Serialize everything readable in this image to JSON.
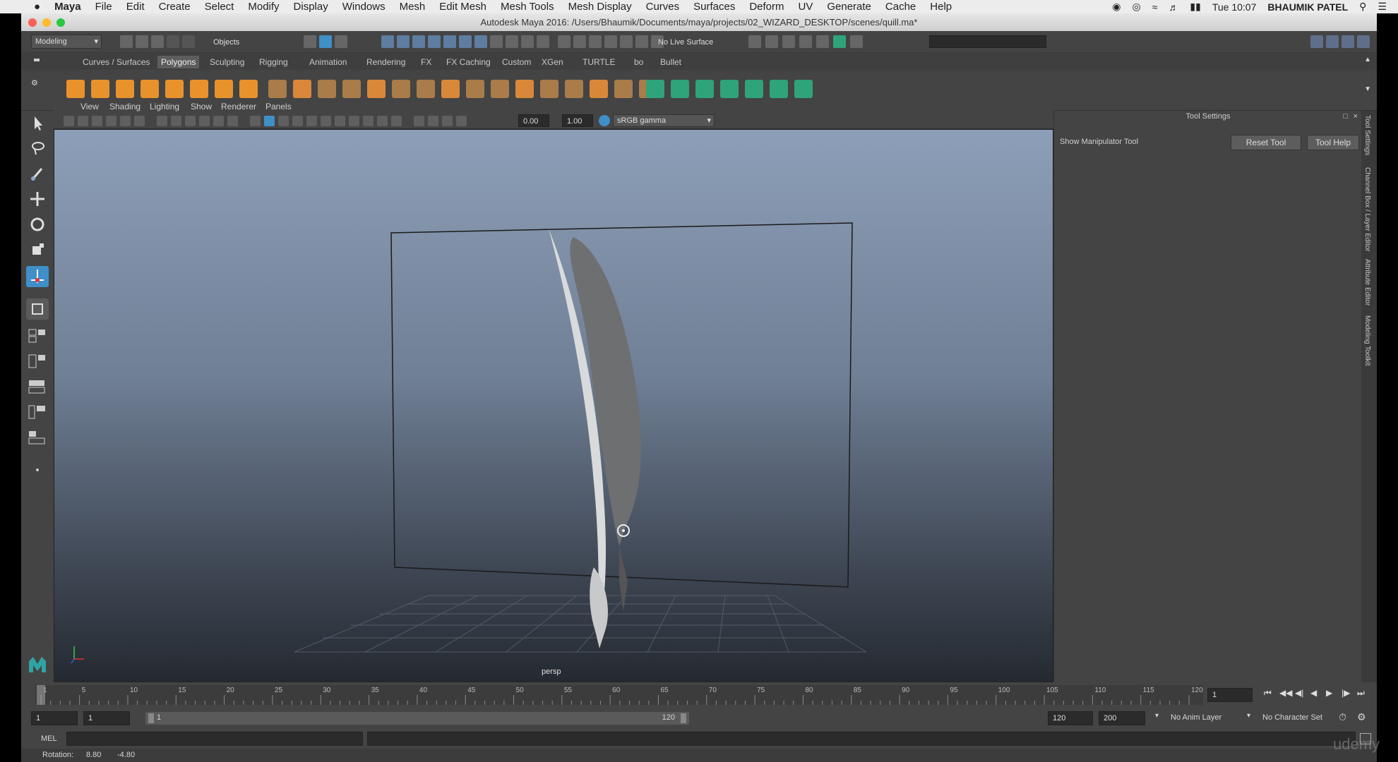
{
  "mac_menu": {
    "app_name": "Maya",
    "items": [
      "File",
      "Edit",
      "Create",
      "Select",
      "Modify",
      "Display",
      "Windows",
      "Mesh",
      "Edit Mesh",
      "Mesh Tools",
      "Mesh Display",
      "Curves",
      "Surfaces",
      "Deform",
      "UV",
      "Generate",
      "Cache",
      "Help"
    ],
    "clock": "Tue 10:07",
    "user": "BHAUMIK PATEL"
  },
  "window": {
    "title": "Autodesk Maya 2016: /Users/Bhaumik/Documents/maya/projects/02_WIZARD_DESKTOP/scenes/quill.ma*"
  },
  "status_line": {
    "menu_set": "Modeling",
    "selection_mode": "Objects",
    "live_surface": "No Live Surface"
  },
  "shelf": {
    "tabs": [
      "Curves / Surfaces",
      "Polygons",
      "Sculpting",
      "Rigging",
      "Animation",
      "Rendering",
      "FX",
      "FX Caching",
      "Custom",
      "XGen",
      "TURTLE",
      "bo",
      "Bullet"
    ],
    "active_tab": "Polygons"
  },
  "viewport": {
    "menu": [
      "View",
      "Shading",
      "Lighting",
      "Show",
      "Renderer",
      "Panels"
    ],
    "exposure": "0.00",
    "gamma": "1.00",
    "color_space": "sRGB gamma",
    "camera": "persp"
  },
  "tool_settings": {
    "title": "Tool Settings",
    "tool_name": "Show Manipulator Tool",
    "reset_label": "Reset Tool",
    "help_label": "Tool Help"
  },
  "side_tabs": [
    "Tool Settings",
    "Channel Box / Layer Editor",
    "Attribute Editor",
    "Modeling Toolkit"
  ],
  "time_slider": {
    "ticks": [
      "1",
      "5",
      "10",
      "15",
      "20",
      "25",
      "30",
      "35",
      "40",
      "45",
      "50",
      "55",
      "60",
      "65",
      "70",
      "75",
      "80",
      "85",
      "90",
      "95",
      "100",
      "105",
      "110",
      "115",
      "120"
    ],
    "current_frame": "1"
  },
  "range_slider": {
    "start": "1",
    "playback_start": "1",
    "range_start_label": "1",
    "range_end_label": "120",
    "playback_end": "120",
    "end": "200",
    "anim_layer": "No Anim Layer",
    "character_set": "No Character Set"
  },
  "command_line": {
    "language": "MEL"
  },
  "help_line": {
    "label": "Rotation:",
    "x": "8.80",
    "y": "-4.80"
  },
  "watermark": "udemy",
  "colors": {
    "active_tool": "#3f8fc9",
    "shelf_orange": "#e8922c",
    "shelf_green": "#2fa37a"
  }
}
